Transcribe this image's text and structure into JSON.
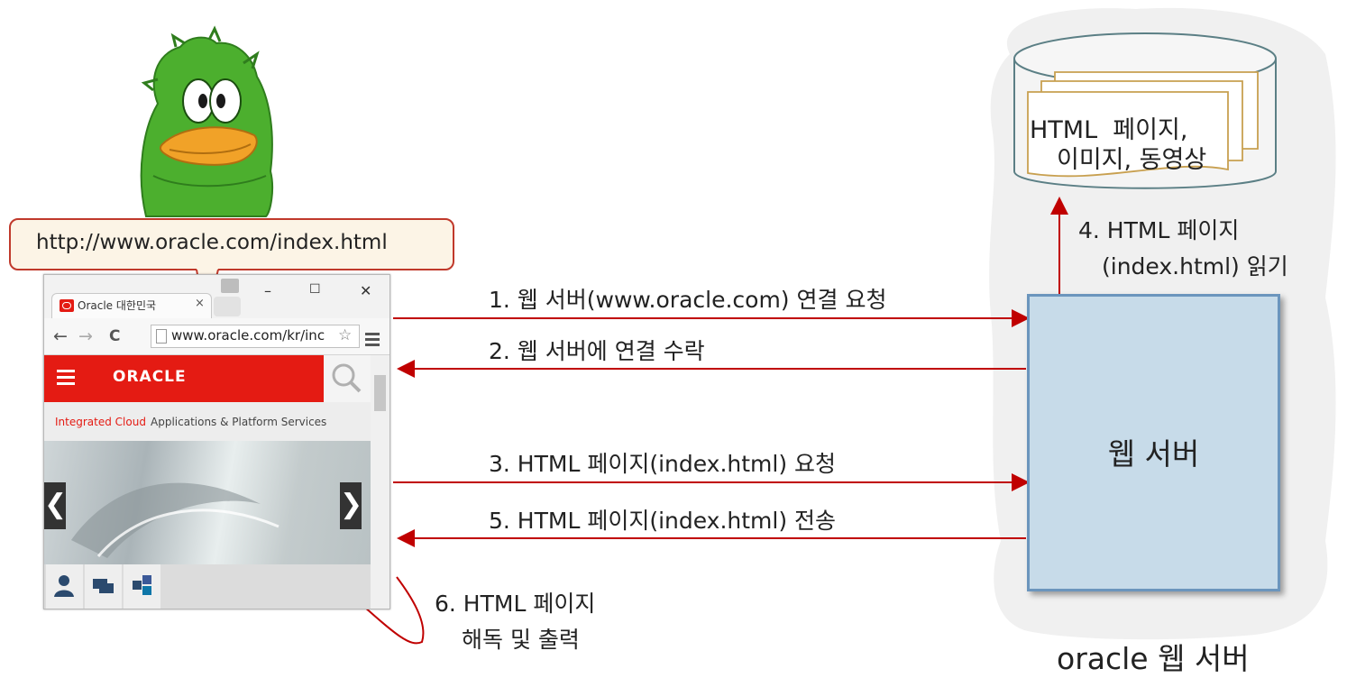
{
  "callout": {
    "url": "http://www.oracle.com/index.html"
  },
  "browser": {
    "tab_title": "Oracle 대한민국",
    "tab_close": "×",
    "min_btn": "–",
    "max_btn": "☐",
    "close_btn": "✕",
    "back": "←",
    "forward": "→",
    "reload": "C",
    "url": "www.oracle.com/kr/inc",
    "star": "☆",
    "page": {
      "logo": "ORACLE",
      "tagline_red": "Integrated Cloud",
      "tagline_grey": "Applications & Platform Services",
      "prev": "❮",
      "next": "❯"
    }
  },
  "arrows": {
    "step1": "1. 웹 서버(www.oracle.com) 연결 요청",
    "step2": "2. 웹 서버에 연결 수락",
    "step3": "3. HTML 페이지(index.html) 요청",
    "step4_line1": "4. HTML 페이지",
    "step4_line2": "(index.html) 읽기",
    "step5": "5. HTML 페이지(index.html) 전송",
    "step6_line1": "6. HTML 페이지",
    "step6_line2": "해독 및 출력"
  },
  "storage": {
    "line1": "HTML  페이지,",
    "line2": "이미지, 동영상"
  },
  "server": {
    "label": "웹 서버",
    "caption": "oracle 웹 서버"
  },
  "colors": {
    "arrow": "#c00000",
    "server_fill": "#c7dbe9",
    "server_border": "#6b95bd",
    "cloud": "#f0f0f0",
    "page_edge": "#c8a050",
    "mascot": "#4caf2e"
  }
}
